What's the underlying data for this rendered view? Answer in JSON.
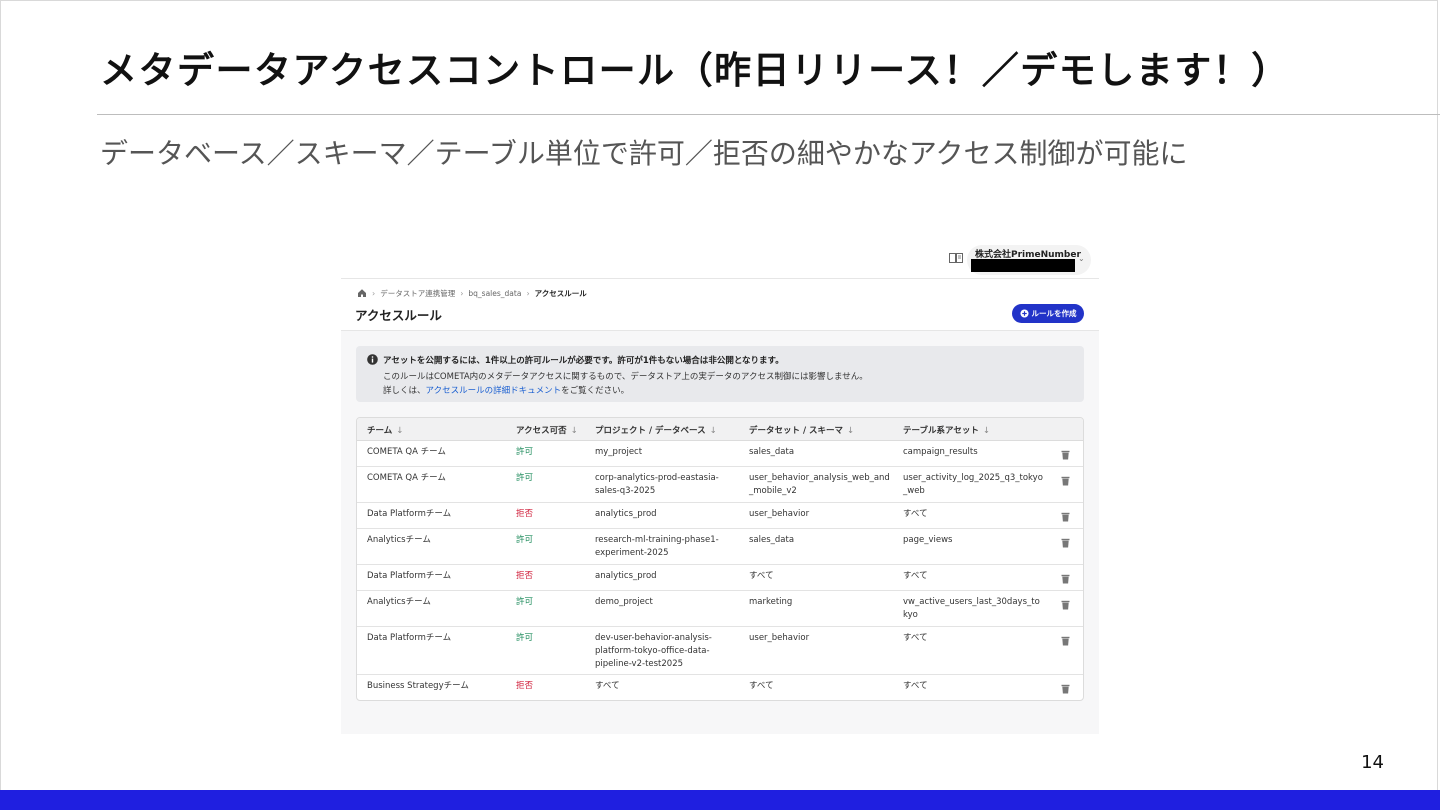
{
  "slide": {
    "title": "メタデータアクセスコントロール（昨日リリース！／デモします！）",
    "subtitle": "データベース／スキーマ／テーブル単位で許可／拒否の細やかなアクセス制御が可能に",
    "page_number": "14",
    "accent_color": "#1f1fe0"
  },
  "app": {
    "org_name": "株式会社PrimeNumber",
    "breadcrumbs": [
      "データストア連携管理",
      "bq_sales_data",
      "アクセスルール"
    ],
    "page_title": "アクセスルール",
    "create_button": "ルールを作成",
    "info": {
      "line1": "アセットを公開するには、1件以上の許可ルールが必要です。許可が1件もない場合は非公開となります。",
      "line2": "このルールはCOMETA内のメタデータアクセスに関するもので、データストア上の実データのアクセス制御には影響しません。",
      "line3_prefix": "詳しくは、",
      "line3_link": "アクセスルールの詳細ドキュメント",
      "line3_suffix": "をご覧ください。"
    },
    "table": {
      "columns": [
        "チーム",
        "アクセス可否",
        "プロジェクト / データベース",
        "データセット / スキーマ",
        "テーブル系アセット"
      ],
      "sort_arrow": "↓",
      "rows": [
        {
          "team": "COMETA QA チーム",
          "access": "許可",
          "project": [
            "my_project"
          ],
          "dataset": [
            "sales_data"
          ],
          "table": [
            "campaign_results"
          ]
        },
        {
          "team": "COMETA QA チーム",
          "access": "許可",
          "project": [
            "corp-analytics-prod-eastasia-",
            "sales-q3-2025"
          ],
          "dataset": [
            "user_behavior_analysis_web_and",
            "_mobile_v2"
          ],
          "table": [
            "user_activity_log_2025_q3_tokyo",
            "_web"
          ]
        },
        {
          "team": "Data Platformチーム",
          "access": "拒否",
          "project": [
            "analytics_prod"
          ],
          "dataset": [
            "user_behavior"
          ],
          "table": [
            "すべて"
          ]
        },
        {
          "team": "Analyticsチーム",
          "access": "許可",
          "project": [
            "research-ml-training-phase1-",
            "experiment-2025"
          ],
          "dataset": [
            "sales_data"
          ],
          "table": [
            "page_views"
          ]
        },
        {
          "team": "Data Platformチーム",
          "access": "拒否",
          "project": [
            "analytics_prod"
          ],
          "dataset": [
            "すべて"
          ],
          "table": [
            "すべて"
          ]
        },
        {
          "team": "Analyticsチーム",
          "access": "許可",
          "project": [
            "demo_project"
          ],
          "dataset": [
            "marketing"
          ],
          "table": [
            "vw_active_users_last_30days_to",
            "kyo"
          ]
        },
        {
          "team": "Data Platformチーム",
          "access": "許可",
          "project": [
            "dev-user-behavior-analysis-",
            "platform-tokyo-office-data-",
            "pipeline-v2-test2025"
          ],
          "dataset": [
            "user_behavior"
          ],
          "table": [
            "すべて"
          ]
        },
        {
          "team": "Business Strategyチーム",
          "access": "拒否",
          "project": [
            "すべて"
          ],
          "dataset": [
            "すべて"
          ],
          "table": [
            "すべて"
          ]
        }
      ]
    }
  }
}
